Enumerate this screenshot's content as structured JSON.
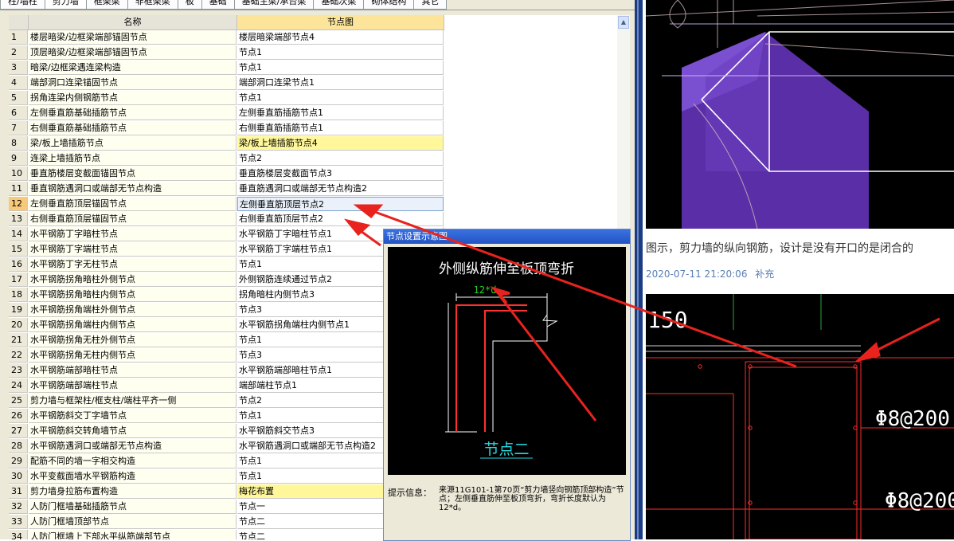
{
  "tabs": [
    "柱/墙柱",
    "剪力墙",
    "框架梁",
    "非框架梁",
    "板",
    "基础",
    "基础主梁/承台梁",
    "基础次梁",
    "砌体结构",
    "其它"
  ],
  "table": {
    "headers": {
      "name": "名称",
      "node": "节点图"
    },
    "rows": [
      {
        "num": "1",
        "name": "楼层暗梁/边框梁端部锚固节点",
        "node": "楼层暗梁端部节点4"
      },
      {
        "num": "2",
        "name": "顶层暗梁/边框梁端部锚固节点",
        "node": "节点1"
      },
      {
        "num": "3",
        "name": "暗梁/边框梁遇连梁构造",
        "node": "节点1"
      },
      {
        "num": "4",
        "name": "端部洞口连梁锚固节点",
        "node": "端部洞口连梁节点1"
      },
      {
        "num": "5",
        "name": "拐角连梁内侧钢筋节点",
        "node": "节点1"
      },
      {
        "num": "6",
        "name": "左侧垂直筋基础插筋节点",
        "node": "左侧垂直筋插筋节点1"
      },
      {
        "num": "7",
        "name": "右侧垂直筋基础插筋节点",
        "node": "右侧垂直筋插筋节点1"
      },
      {
        "num": "8",
        "name": "梁/板上墙插筋节点",
        "node": "梁/板上墙插筋节点4",
        "highlight": "yellow"
      },
      {
        "num": "9",
        "name": "连梁上墙插筋节点",
        "node": "节点2"
      },
      {
        "num": "10",
        "name": "垂直筋楼层变截面锚固节点",
        "node": "垂直筋楼层变截面节点3"
      },
      {
        "num": "11",
        "name": "垂直钢筋遇洞口或端部无节点构造",
        "node": "垂直筋遇洞口或端部无节点构造2"
      },
      {
        "num": "12",
        "name": "左侧垂直筋顶层锚固节点",
        "node": "左侧垂直筋顶层节点2",
        "highlight": "selected"
      },
      {
        "num": "13",
        "name": "右侧垂直筋顶层锚固节点",
        "node": "右侧垂直筋顶层节点2"
      },
      {
        "num": "14",
        "name": "水平钢筋丁字暗柱节点",
        "node": "水平钢筋丁字暗柱节点1"
      },
      {
        "num": "15",
        "name": "水平钢筋丁字端柱节点",
        "node": "水平钢筋丁字端柱节点1"
      },
      {
        "num": "16",
        "name": "水平钢筋丁字无柱节点",
        "node": "节点1"
      },
      {
        "num": "17",
        "name": "水平钢筋拐角暗柱外侧节点",
        "node": "外侧钢筋连续通过节点2"
      },
      {
        "num": "18",
        "name": "水平钢筋拐角暗柱内侧节点",
        "node": "拐角暗柱内侧节点3"
      },
      {
        "num": "19",
        "name": "水平钢筋拐角端柱外侧节点",
        "node": "节点3"
      },
      {
        "num": "20",
        "name": "水平钢筋拐角端柱内侧节点",
        "node": "水平钢筋拐角端柱内侧节点1"
      },
      {
        "num": "21",
        "name": "水平钢筋拐角无柱外侧节点",
        "node": "节点1"
      },
      {
        "num": "22",
        "name": "水平钢筋拐角无柱内侧节点",
        "node": "节点3"
      },
      {
        "num": "23",
        "name": "水平钢筋端部暗柱节点",
        "node": "水平钢筋端部暗柱节点1"
      },
      {
        "num": "24",
        "name": "水平钢筋端部端柱节点",
        "node": "端部端柱节点1"
      },
      {
        "num": "25",
        "name": "剪力墙与框架柱/框支柱/端柱平齐一侧",
        "node": "节点2"
      },
      {
        "num": "26",
        "name": "水平钢筋斜交丁字墙节点",
        "node": "节点1"
      },
      {
        "num": "27",
        "name": "水平钢筋斜交转角墙节点",
        "node": "水平钢筋斜交节点3"
      },
      {
        "num": "28",
        "name": "水平钢筋遇洞口或端部无节点构造",
        "node": "水平钢筋遇洞口或端部无节点构造2"
      },
      {
        "num": "29",
        "name": "配筋不同的墙一字相交构造",
        "node": "节点1"
      },
      {
        "num": "30",
        "name": "水平变截面墙水平钢筋构造",
        "node": "节点1"
      },
      {
        "num": "31",
        "name": "剪力墙身拉筋布置构造",
        "node": "梅花布置",
        "highlight": "yellow"
      },
      {
        "num": "32",
        "name": "人防门框墙基础插筋节点",
        "node": "节点一"
      },
      {
        "num": "33",
        "name": "人防门框墙顶部节点",
        "node": "节点二"
      },
      {
        "num": "34",
        "name": "人防门框墙上下部水平纵筋端部节点",
        "node": "节点二"
      }
    ]
  },
  "dialog": {
    "title": "节点设置示意图",
    "diagram_title": "外侧纵筋伸至板顶弯折",
    "dimension": "12*d",
    "node_label": "节点二",
    "info_label": "提示信息：",
    "info_text": "来源11G101-1第70页“剪力墙竖向钢筋顶部构造”节点；左侧垂直筋伸至板顶弯折，弯折长度默认为12*d。"
  },
  "article": {
    "caption": "图示，剪力墙的纵向钢筋，设计是没有开口的是闭合的",
    "timestamp": "2020-07-11 21:20:06",
    "action": "补充",
    "cad_labels": {
      "dim": "150",
      "rebar1": "Φ8@200",
      "rebar2": "Φ8@200"
    }
  },
  "colors": {
    "accent_arrow": "#e8231e",
    "cad_background": "#000000",
    "cad_line": "#ff2b2b"
  }
}
